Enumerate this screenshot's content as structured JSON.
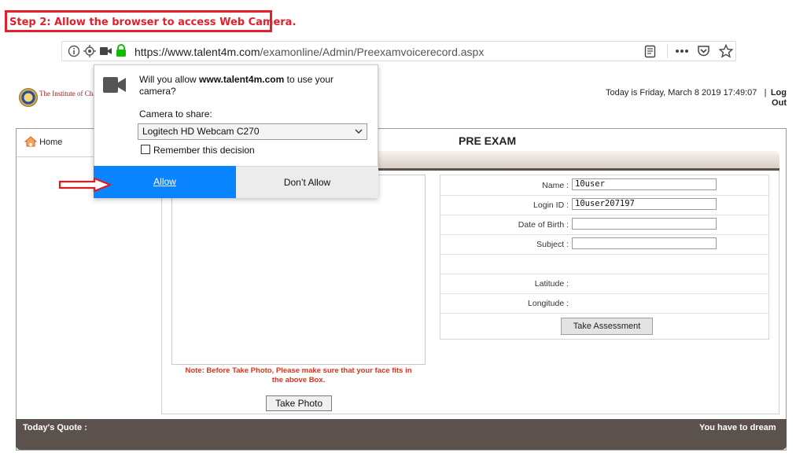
{
  "step_caption": "Step 2: Allow the browser to access Web Camera.",
  "browser": {
    "url_domain": "https://www.talent4m.com",
    "url_path": "/examonline/Admin/Preexamvoicerecord.aspx",
    "icons": [
      "info-icon",
      "location-icon",
      "camera-icon",
      "lock-icon",
      "reader-view-icon",
      "more-icon",
      "pocket-icon",
      "bookmark-star-icon"
    ]
  },
  "header": {
    "org_name": "The Institute of Charter",
    "datetime": "Today is Friday, March 8 2019 17:49:07",
    "separator": "|",
    "logout_line1": "Log",
    "logout_line2": "Out"
  },
  "nav": {
    "home_label": "Home"
  },
  "main": {
    "title": "PRE EXAM",
    "note_line1": "Note: Before Take Photo, Please make sure that your face fits in",
    "note_line2": "the above Box.",
    "take_photo_label": "Take Photo",
    "form": {
      "name_label": "Name :",
      "name_value": "10user",
      "login_label": "Login ID :",
      "login_value": "10user207197",
      "dob_label": "Date of Birth :",
      "dob_value": "",
      "subject_label": "Subject :",
      "subject_value": "",
      "latitude_label": "Latitude :",
      "longitude_label": "Longitude :",
      "take_assessment_label": "Take Assessment"
    }
  },
  "footer": {
    "quote_label": "Today's Quote :",
    "quote_text": "You have to dream"
  },
  "popup": {
    "question_prefix": "Will you allow ",
    "question_domain": "www.talent4m.com",
    "question_suffix": " to use your camera?",
    "camera_label": "Camera to share:",
    "camera_selected": "Logitech HD Webcam C270",
    "remember_label": "Remember this decision",
    "allow_label": "Allow",
    "deny_label": "Don’t Allow"
  },
  "colors": {
    "caption_red": "#e2212b",
    "allow_blue": "#0a84ff",
    "footer_brown": "#5c524d",
    "note_red": "#d9341c"
  }
}
